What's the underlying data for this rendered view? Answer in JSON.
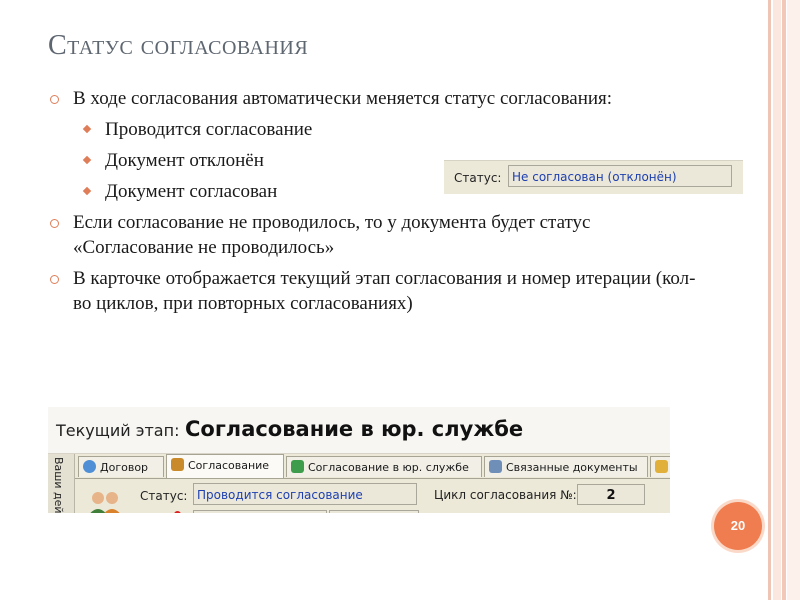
{
  "slide": {
    "title": "Статус согласования",
    "page_number": "20",
    "accent_color": "#e07d59"
  },
  "bullets": [
    {
      "text": "В ходе согласования автоматически меняется статус согласования:",
      "sub": [
        {
          "text": "Проводится согласование"
        },
        {
          "text": "Документ отклонён"
        },
        {
          "text": "Документ согласован"
        }
      ]
    },
    {
      "text": "Если согласование не проводилось, то у документа будет статус «Согласование не проводилось»"
    },
    {
      "text": "В карточке отображается текущий этап согласования и номер итерации (кол-во циклов, при повторных согласованиях)"
    }
  ],
  "status_snippet": {
    "label": "Статус:",
    "value": "Не согласован (отклонён)"
  },
  "card": {
    "stage_label": "Текущий этап:",
    "stage_value": "Согласование в юр. службе",
    "side_label": "Ваши дей",
    "tabs": [
      {
        "label": "Договор",
        "icon": "contract-icon"
      },
      {
        "label": "Согласование",
        "icon": "people-icon"
      },
      {
        "label": "Согласование в юр. службе",
        "icon": "person-icon"
      },
      {
        "label": "Связанные документы",
        "icon": "documents-icon"
      }
    ],
    "status_label": "Статус:",
    "status_value": "Проводится согласование",
    "cycle_label": "Цикл согласования №:",
    "cycle_value": "2"
  }
}
